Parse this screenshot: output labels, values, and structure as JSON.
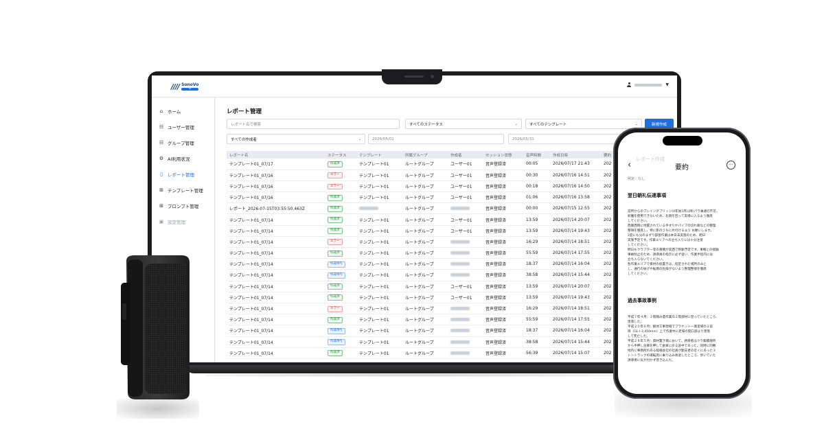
{
  "app": {
    "logo_mark": "////",
    "logo_name": "SonoVo",
    "logo_badge": "AI"
  },
  "sidebar": {
    "items": [
      {
        "label": "ホーム",
        "icon": "home-icon"
      },
      {
        "label": "ユーザー管理",
        "icon": "users-icon"
      },
      {
        "label": "グループ管理",
        "icon": "group-icon"
      },
      {
        "label": "AI利用状況",
        "icon": "gear-icon"
      },
      {
        "label": "レポート管理",
        "icon": "document-icon"
      },
      {
        "label": "テンプレート管理",
        "icon": "hierarchy-icon"
      },
      {
        "label": "プロンプト管理",
        "icon": "hierarchy-icon"
      },
      {
        "label": "設定管理",
        "icon": "settings-doc-icon"
      }
    ]
  },
  "main": {
    "title": "レポート管理",
    "search_placeholder": "レポート名で検索",
    "status_filter": "すべてのステータス",
    "template_filter": "すべてのテンプレート",
    "new_button": "新規作成",
    "creator_filter": "すべての作成者",
    "date_from": "2026/05/01",
    "date_to": "2026/05/31"
  },
  "table": {
    "headers": [
      "レポート名",
      "ステータス",
      "テンプレート",
      "所属グループ",
      "作成者",
      "セッション状態",
      "音声時間",
      "作成日時",
      "要約"
    ],
    "rows": [
      {
        "name": "テンプレート01_07/17",
        "status": "作成済",
        "kind": "ok",
        "template": "テンプレート01",
        "group": "ルートグループ",
        "creator": "ユーザー01",
        "session": "音声登録済",
        "duration": "00:05",
        "created": "2026/07/17 21:43",
        "extra": "202"
      },
      {
        "name": "テンプレート01_07/16",
        "status": "エラー",
        "kind": "err",
        "template": "テンプレート01",
        "group": "ルートグループ",
        "creator": "ユーザー01",
        "session": "音声登録済",
        "duration": "00:30",
        "created": "2026/07/16 14:51",
        "extra": "202"
      },
      {
        "name": "テンプレート01_07/16",
        "status": "エラー",
        "kind": "err",
        "template": "テンプレート01",
        "group": "ルートグループ",
        "creator": "ユーザー01",
        "session": "音声登録済",
        "duration": "00:18",
        "created": "2026/07/16 14:50",
        "extra": "202"
      },
      {
        "name": "テンプレート01_07/16",
        "status": "作成済",
        "kind": "ok",
        "template": "テンプレート01",
        "group": "ルートグループ",
        "creator": "ユーザー01",
        "session": "音声登録済",
        "duration": "01:06",
        "created": "2026/07/16 13:58",
        "extra": "202"
      },
      {
        "name": "レポート_2026-07-15T03:55:50.463Z",
        "status": "作成済",
        "kind": "ok",
        "template": "",
        "group": "ルートグループ",
        "creator": "",
        "session": "音声登録済",
        "duration": "00:00",
        "created": "2026/07/15 12:55",
        "extra": "202"
      },
      {
        "name": "テンプレート01_07/14",
        "status": "作成済",
        "kind": "ok",
        "template": "テンプレート01",
        "group": "ルートグループ",
        "creator": "ユーザー01",
        "session": "音声登録済",
        "duration": "13:59",
        "created": "2026/07/14 20:07",
        "extra": "202"
      },
      {
        "name": "テンプレート01_07/14",
        "status": "作成済",
        "kind": "ok",
        "template": "テンプレート01",
        "group": "ルートグループ",
        "creator": "ユーザー01",
        "session": "音声登録済",
        "duration": "13:59",
        "created": "2026/07/14 19:43",
        "extra": "202"
      },
      {
        "name": "テンプレート01_07/14",
        "status": "エラー",
        "kind": "err",
        "template": "テンプレート01",
        "group": "ルートグループ",
        "creator": "",
        "session": "音声登録済",
        "duration": "16:29",
        "created": "2026/07/14 18:51",
        "extra": "202"
      },
      {
        "name": "テンプレート01_07/14",
        "status": "作成済",
        "kind": "ok",
        "template": "テンプレート01",
        "group": "ルートグループ",
        "creator": "",
        "session": "音声登録済",
        "duration": "55:59",
        "created": "2026/07/14 17:55",
        "extra": "202"
      },
      {
        "name": "テンプレート01_07/14",
        "status": "作成待ち",
        "kind": "wait",
        "template": "テンプレート01",
        "group": "ルートグループ",
        "creator": "",
        "session": "音声登録済",
        "duration": "18:37",
        "created": "2026/07/14 16:04",
        "extra": "202"
      },
      {
        "name": "テンプレート01_07/14",
        "status": "作成待ち",
        "kind": "wait",
        "template": "テンプレート01",
        "group": "ルートグループ",
        "creator": "",
        "session": "音声登録済",
        "duration": "38:58",
        "created": "2026/07/14 15:44",
        "extra": "202"
      },
      {
        "name": "テンプレート01_07/14",
        "status": "作成済",
        "kind": "ok",
        "template": "テンプレート01",
        "group": "ルートグループ",
        "creator": "ユーザー01",
        "session": "音声登録済",
        "duration": "13:59",
        "created": "2026/07/14 20:07",
        "extra": "202"
      },
      {
        "name": "テンプレート01_07/14",
        "status": "作成済",
        "kind": "ok",
        "template": "テンプレート01",
        "group": "ルートグループ",
        "creator": "ユーザー01",
        "session": "音声登録済",
        "duration": "13:59",
        "created": "2026/07/14 19:43",
        "extra": "202"
      },
      {
        "name": "テンプレート01_07/14",
        "status": "エラー",
        "kind": "err",
        "template": "テンプレート01",
        "group": "ルートグループ",
        "creator": "",
        "session": "音声登録済",
        "duration": "16:29",
        "created": "2026/07/14 18:51",
        "extra": "202"
      },
      {
        "name": "テンプレート01_07/14",
        "status": "作成済",
        "kind": "ok",
        "template": "テンプレート01",
        "group": "ルートグループ",
        "creator": "",
        "session": "音声登録済",
        "duration": "55:59",
        "created": "2026/07/14 17:55",
        "extra": "202"
      },
      {
        "name": "テンプレート01_07/14",
        "status": "作成待ち",
        "kind": "wait",
        "template": "テンプレート01",
        "group": "ルートグループ",
        "creator": "",
        "session": "音声登録済",
        "duration": "18:37",
        "created": "2026/07/14 16:04",
        "extra": "202"
      },
      {
        "name": "テンプレート01_07/14",
        "status": "作成待ち",
        "kind": "wait",
        "template": "テンプレート01",
        "group": "ルートグループ",
        "creator": "",
        "session": "音声登録済",
        "duration": "38:58",
        "created": "2026/07/14 15:44",
        "extra": "202"
      },
      {
        "name": "テンプレート01_07/14",
        "status": "作成済",
        "kind": "ok",
        "template": "テンプレート01",
        "group": "ルートグループ",
        "creator": "",
        "session": "音声登録済",
        "duration": "56:39",
        "created": "2026/07/14 15:07",
        "extra": "202"
      }
    ]
  },
  "phone": {
    "ghost": "レポート作成",
    "title": "要約",
    "example": "例定：なし",
    "section1_title": "翌日朝礼伝達事項",
    "section1_lines": [
      "認所からのプレイングブリッジ(4年後1両以降)パラ乗通行不可。",
      "邪魔を使用できないため、北側を回って実場に入るよう徹底",
      "してください。",
      "西搬西側に地置されている手すりやパイプの切れ端などの整理",
      "整頓を徹底し、特に影のうちに片付けるよう お願いします。",
      "2度にも分のまずり部屋作業は本日未実施のため、明日",
      "実施予定です。作業エリアへの立ち入りには十分注意",
      "してください。",
      "明日もクラブター等の重機が実西で移動予定です。重機との接触",
      "事故防止のため、誘導員の指示に必ず従い、作業半径内には",
      "立ち入らないでください。",
      "各作業エリアで資材の仮置きは、指定された場所のみと",
      "し、通行の妨げや転倒の危険がないよう整理整頓を徹底",
      "してください。"
    ],
    "section2_title": "過去事故事例",
    "section2_lines": [
      "平成７年４月：２階踏み遺作業の２階部材に登っていたところ、",
      "墜落した。",
      "平成２０年６月：解体工事現場でプラケット一側足場の２段",
      "目（GL＋3,450mm）上で作業中に足場の開口部より墜落",
      "して死亡した。",
      "平成２９年５月：資材置き場において、誘導者はクラ集積場所",
      "から手押し台車を押して倉庫に戻る途中であった。同時に同敷",
      "地内に事務所のある経検会社の社員が勤支者の近くにあった３",
      "トントラックの運転席に乗り込み後退したところ、歩いていた",
      "誘導者に気が付かず巻き込んだ。"
    ]
  }
}
